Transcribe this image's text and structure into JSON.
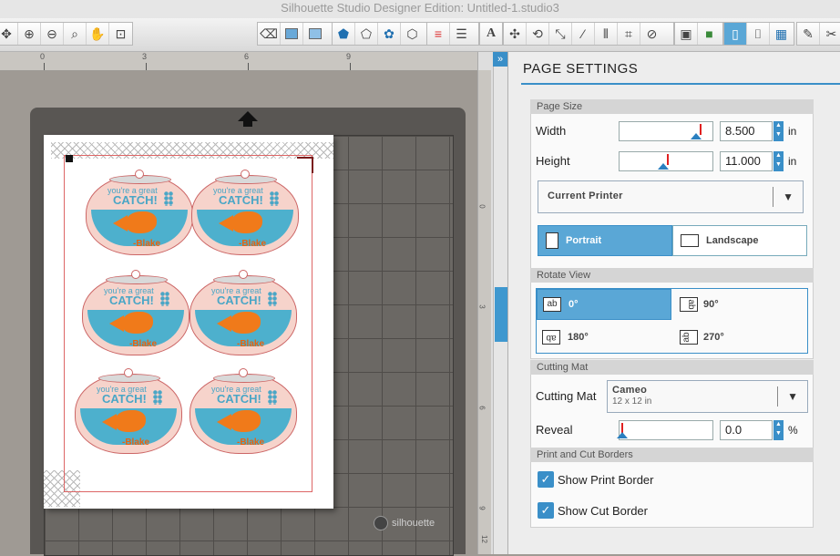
{
  "window": {
    "title": "Silhouette Studio Designer Edition: Untitled-1.studio3"
  },
  "toolbar": {
    "zoom_group": [
      "move-icon",
      "zoom-in-icon",
      "zoom-out-icon",
      "zoom-select-icon",
      "pan-icon",
      "fit-to-page-icon"
    ],
    "right_groups": [
      "eraser-icon",
      "fill-icon",
      "pattern-icon",
      "shape-fill-icon",
      "polygon-icon",
      "star-icon",
      "blob-icon",
      "line-color-icon",
      "line-style-icon",
      "text-icon",
      "replicate-icon",
      "rotate-icon",
      "scale-icon",
      "offset-icon",
      "align-icon",
      "knife-icon",
      "store-icon",
      "registration-icon",
      "page-settings-icon",
      "cut-settings-icon",
      "grid-icon",
      "design-store-icon",
      "library-icon"
    ]
  },
  "canvas": {
    "ruler_labels": [
      "0",
      "3",
      "6",
      "9"
    ],
    "side_ruler_labels": [
      "0",
      "3",
      "6",
      "9",
      "12"
    ],
    "brand": "silhouette",
    "cards": [
      {
        "line1": "you're a great",
        "line2": "CATCH!",
        "sig": "-Blake"
      },
      {
        "line1": "you're a great",
        "line2": "CATCH!",
        "sig": "-Blake"
      },
      {
        "line1": "you're a great",
        "line2": "CATCH!",
        "sig": "-Blake"
      },
      {
        "line1": "you're a great",
        "line2": "CATCH!",
        "sig": "-Blake"
      },
      {
        "line1": "you're a great",
        "line2": "CATCH!",
        "sig": "-Blake"
      },
      {
        "line1": "you're a great",
        "line2": "CATCH!",
        "sig": "-Blake"
      }
    ],
    "collapse_label": "»"
  },
  "panel": {
    "title": "PAGE SETTINGS",
    "page_size": {
      "header": "Page Size",
      "width_label": "Width",
      "width_value": "8.500",
      "width_unit": "in",
      "height_label": "Height",
      "height_value": "11.000",
      "height_unit": "in",
      "media": "Current Printer",
      "portrait": "Portrait",
      "landscape": "Landscape"
    },
    "rotate_view": {
      "header": "Rotate View",
      "options": [
        "0°",
        "90°",
        "180°",
        "270°"
      ]
    },
    "cutting_mat": {
      "header": "Cutting Mat",
      "label": "Cutting Mat",
      "value": "Cameo",
      "subvalue": "12 x 12 in",
      "reveal_label": "Reveal",
      "reveal_value": "0.0",
      "reveal_unit": "%"
    },
    "borders": {
      "header": "Print and Cut Borders",
      "print_border": "Show Print Border",
      "cut_border": "Show Cut Border"
    }
  },
  "colors": {
    "accent": "#3a8fc8",
    "mat": "#595653",
    "fish": "#f07a1a",
    "water": "#4db0cd"
  }
}
